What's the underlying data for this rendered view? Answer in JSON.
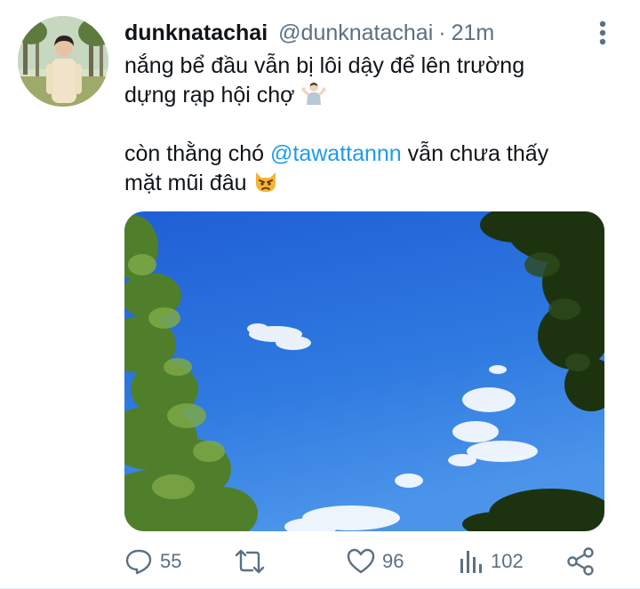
{
  "tweet": {
    "display_name": "dunknatachai",
    "handle": "@dunknatachai",
    "separator": "·",
    "time": "21m",
    "line1": "nắng bể đầu vẫn bị lôi dậy để lên trường",
    "line2": "dựng rạp hội chợ",
    "line2_emoji": "person-shrugging-icon",
    "line3_prefix": "còn thằng chó ",
    "mention": "@tawattannn",
    "line3_suffix": " vẫn chưa thấy",
    "line4": "mặt mũi đâu",
    "line4_emoji": "pouting-cat-icon"
  },
  "media": {
    "description_icon": "sky-photo"
  },
  "actions": {
    "reply_count": "55",
    "retweet_count": "",
    "like_count": "96",
    "views_count": "102"
  },
  "colors": {
    "accent": "#1d9bf0",
    "muted": "#5b7083",
    "text": "#0f1419"
  }
}
